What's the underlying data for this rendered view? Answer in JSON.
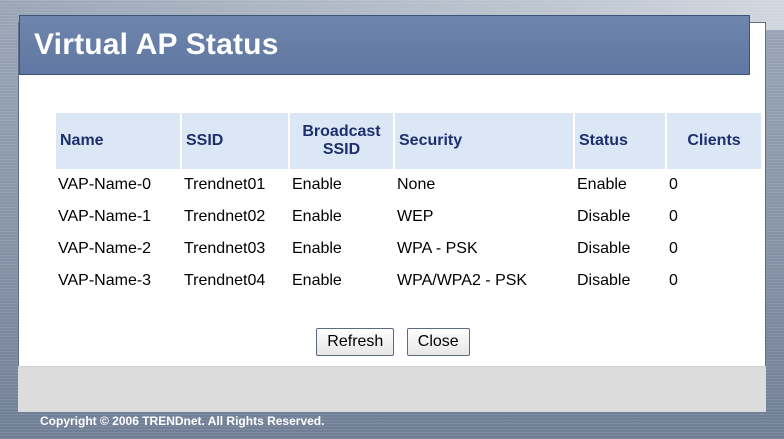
{
  "page": {
    "title": "Virtual AP Status",
    "copyright": "Copyright © 2006 TRENDnet. All Rights Reserved."
  },
  "table": {
    "headers": {
      "name": "Name",
      "ssid": "SSID",
      "broadcast_line1": "Broadcast",
      "broadcast_line2": "SSID",
      "security": "Security",
      "status": "Status",
      "clients": "Clients"
    },
    "rows": [
      {
        "name": "VAP-Name-0",
        "ssid": "Trendnet01",
        "broadcast": "Enable",
        "security": "None",
        "status": "Enable",
        "clients": "0"
      },
      {
        "name": "VAP-Name-1",
        "ssid": "Trendnet02",
        "broadcast": "Enable",
        "security": "WEP",
        "status": "Disable",
        "clients": "0"
      },
      {
        "name": "VAP-Name-2",
        "ssid": "Trendnet03",
        "broadcast": "Enable",
        "security": "WPA - PSK",
        "status": "Disable",
        "clients": "0"
      },
      {
        "name": "VAP-Name-3",
        "ssid": "Trendnet04",
        "broadcast": "Enable",
        "security": "WPA/WPA2 - PSK",
        "status": "Disable",
        "clients": "0"
      }
    ]
  },
  "buttons": {
    "refresh": "Refresh",
    "close": "Close"
  },
  "colors": {
    "title_bar": "#6f85ad",
    "header_bg": "#dbe7f5",
    "header_text": "#1e2f6e",
    "frame": "#8593a7"
  }
}
